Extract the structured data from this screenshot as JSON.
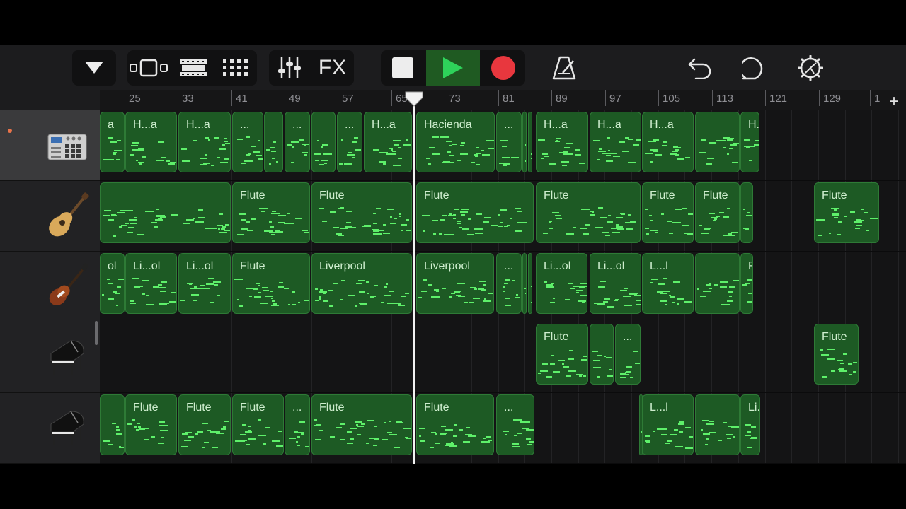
{
  "app": "GarageBand",
  "toolbar": {
    "fx_label": "FX",
    "buttons": [
      "menu-dropdown",
      "tracks-view",
      "live-loops",
      "grid-view",
      "mixer",
      "fx",
      "stop",
      "play",
      "record",
      "metronome",
      "undo",
      "loop-browser",
      "settings"
    ]
  },
  "colors": {
    "region_bg": "#1d5a24",
    "note": "#5ef06a",
    "record": "#e8373e",
    "play": "#2ed25a"
  },
  "ruler": {
    "labels": [
      "25",
      "33",
      "41",
      "49",
      "57",
      "65",
      "73",
      "81",
      "89",
      "97",
      "105",
      "113",
      "121",
      "129",
      "1"
    ],
    "add_track_label": "+"
  },
  "tracks": [
    {
      "icon": "drum-machine-icon",
      "selected": true,
      "regions": [
        {
          "label": "a"
        },
        {
          "label": "H...a"
        },
        {
          "label": "H...a"
        },
        {
          "label": "..."
        },
        {
          "label": ""
        },
        {
          "label": "..."
        },
        {
          "label": ""
        },
        {
          "label": "..."
        },
        {
          "label": "H...a"
        },
        {
          "label": "Hacienda"
        },
        {
          "label": "..."
        },
        {
          "label": ""
        },
        {
          "label": "H...a"
        },
        {
          "label": "H...a"
        },
        {
          "label": "H...a"
        },
        {
          "label": "H...a"
        },
        {
          "label": ""
        },
        {
          "label": "H...a"
        }
      ]
    },
    {
      "icon": "acoustic-guitar-icon",
      "selected": false,
      "regions": [
        {
          "label": ""
        },
        {
          "label": "Flute"
        },
        {
          "label": "Flute"
        },
        {
          "label": "Flute"
        },
        {
          "label": "Flute"
        },
        {
          "label": "Flute"
        },
        {
          "label": "Flute"
        },
        {
          "label": ""
        },
        {
          "label": "Flute"
        }
      ]
    },
    {
      "icon": "bass-guitar-icon",
      "selected": false,
      "regions": [
        {
          "label": "ol"
        },
        {
          "label": "Li...ol"
        },
        {
          "label": "Li...ol"
        },
        {
          "label": "Flute"
        },
        {
          "label": "Liverpool"
        },
        {
          "label": "Liverpool"
        },
        {
          "label": "..."
        },
        {
          "label": ""
        },
        {
          "label": "Li...ol"
        },
        {
          "label": "Li...ol"
        },
        {
          "label": "Li...ol"
        },
        {
          "label": "L...l"
        },
        {
          "label": ""
        },
        {
          "label": "Flute"
        }
      ]
    },
    {
      "icon": "grand-piano-icon",
      "selected": false,
      "regions": [
        {
          "label": "Flute"
        },
        {
          "label": ""
        },
        {
          "label": "..."
        },
        {
          "label": "Flute"
        }
      ]
    },
    {
      "icon": "grand-piano-icon",
      "selected": false,
      "regions": [
        {
          "label": ""
        },
        {
          "label": "Flute"
        },
        {
          "label": "Flute"
        },
        {
          "label": "Flute"
        },
        {
          "label": "..."
        },
        {
          "label": "Flute"
        },
        {
          "label": "Flute"
        },
        {
          "label": "..."
        },
        {
          "label": "Flute"
        },
        {
          "label": "L...l"
        },
        {
          "label": ""
        },
        {
          "label": "Li...ol"
        }
      ]
    }
  ]
}
